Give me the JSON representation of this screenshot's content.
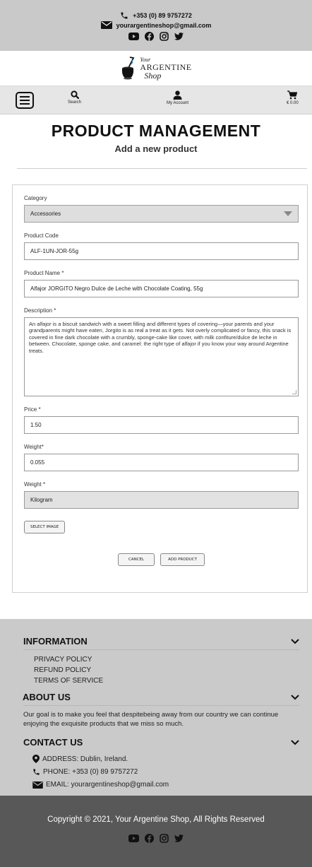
{
  "contact": {
    "phone": "+353 (0) 89 9757272",
    "email": "yourargentineshop@gmail.com"
  },
  "logo": {
    "your": "Your",
    "argentine": "ARGENTINE",
    "shop": "Shop"
  },
  "nav": {
    "search_label": "Search",
    "account_label": "My Account",
    "cart_amount": "€ 0.00"
  },
  "page": {
    "title": "PRODUCT MANAGEMENT",
    "subtitle": "Add a new product"
  },
  "form": {
    "category_label": "Category",
    "category_value": "Accessories",
    "code_label": "Product Code",
    "code_value": "ALF-1UN-JOR-55g",
    "name_label": "Product Name *",
    "name_value": "Alfajor JORGITO Negro Dulce de Leche with Chocolate Coating, 55g",
    "description_label": "Description *",
    "description_value": "An alfajor is a biscuit sandwich with a sweet filling and different types of covering—your parents and your grandparents might have eaten, Jorgito is as real a treat as it gets. Not overly complicated or fancy, this snack is covered in fine dark chocolate with a crumbly, sponge-cake like cover, with milk confiture/dulce de leche in between. Chocolate, sponge cake, and caramel: the right type of alfajor if you know your way around Argentine treats.",
    "price_label": "Price *",
    "price_value": "1.50",
    "weight_label": "Weight*",
    "weight_value": "0.055",
    "unit_label": "Weight *",
    "unit_value": "Kilogram",
    "select_image_label": "SELECT IMAGE",
    "cancel_label": "CANCEL",
    "add_label": "ADD PRODUCT"
  },
  "footer": {
    "info_title": "INFORMATION",
    "info_links": [
      "PRIVACY POLICY",
      "REFUND POLICY",
      "TERMS OF SERVICE"
    ],
    "about_title": "ABOUT US",
    "about_text": "Our goal is to make you feel that despitebeing away from our country we can continue enjoying the exquisite products that we miss so much.",
    "contact_title": "CONTACT US",
    "address": "ADDRESS: Dublin, Ireland.",
    "phone": "PHONE: +353 (0) 89 9757272",
    "email": "EMAIL: yourargentineshop@gmail.com",
    "copyright": "Copyright © 2021, Your Argentine Shop,  All Rights Reserved"
  },
  "icons": {
    "phone": "phone-icon",
    "email": "envelope-icon",
    "youtube": "youtube-icon",
    "facebook": "facebook-icon",
    "instagram": "instagram-icon",
    "twitter": "twitter-icon",
    "menu": "hamburger-menu-icon",
    "search": "search-icon",
    "account": "user-icon",
    "cart": "cart-icon",
    "chevron": "chevron-down-icon",
    "location": "location-pin-icon"
  },
  "colors": {
    "topbar_bg": "#c9c9c9",
    "footer_bg": "#cacaca",
    "copyright_bg": "#585858",
    "logo_blue": "#3f8fc4"
  }
}
